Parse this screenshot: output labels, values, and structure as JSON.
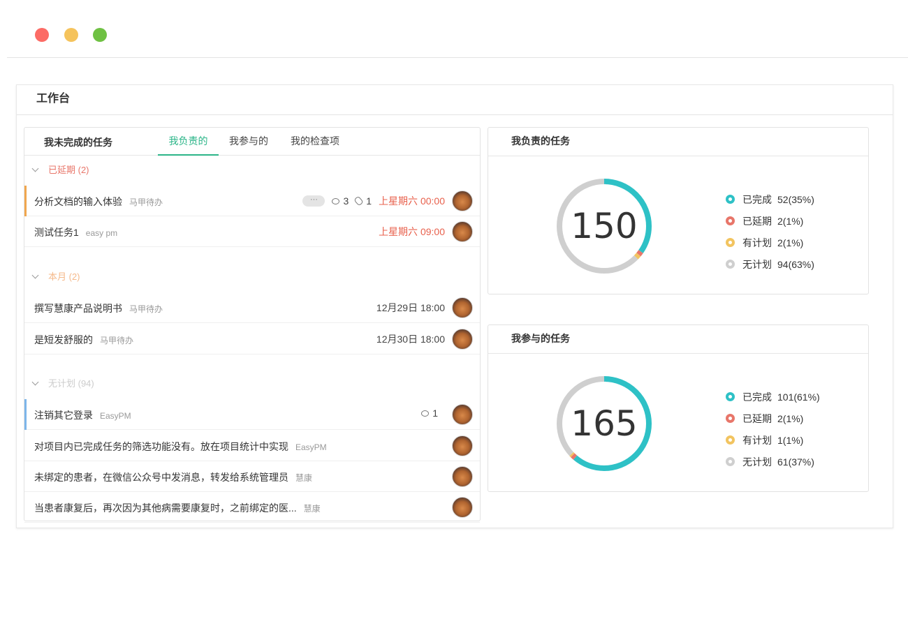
{
  "window": {
    "controls": [
      "close",
      "minimize",
      "zoom"
    ]
  },
  "workbench": {
    "title": "工作台"
  },
  "tasks": {
    "panel_title": "我未完成的任务",
    "tabs": [
      {
        "label": "我负责的",
        "active": true
      },
      {
        "label": "我参与的",
        "active": false
      },
      {
        "label": "我的检查项",
        "active": false
      }
    ],
    "groups": [
      {
        "label": "已延期 (2)",
        "color": "#e8766a",
        "rows": [
          {
            "title": "分析文档的输入体验",
            "project": "马甲待办",
            "accent": "#f0a64e",
            "more": "···",
            "comments": "3",
            "attachments": "1",
            "due": "上星期六 00:00",
            "late": true
          },
          {
            "title": "测试任务1",
            "project": "easy pm",
            "accent": "",
            "due": "上星期六 09:00",
            "late": true
          }
        ]
      },
      {
        "label": "本月 (2)",
        "color": "#f5b98a",
        "rows": [
          {
            "title": "撰写慧康产品说明书",
            "project": "马甲待办",
            "accent": "",
            "due": "12月29日 18:00",
            "late": false
          },
          {
            "title": "是短发舒服的",
            "project": "马甲待办",
            "accent": "",
            "due": "12月30日 18:00",
            "late": false
          }
        ]
      },
      {
        "label": "无计划 (94)",
        "color": "#cccccc",
        "rows": [
          {
            "title": "注销其它登录",
            "project": "EasyPM",
            "accent": "#7db6ea",
            "comments": "1",
            "due": "",
            "late": false
          },
          {
            "title": "对项目内已完成任务的筛选功能没有。放在项目统计中实现",
            "project": "EasyPM",
            "accent": "",
            "due": "",
            "late": false
          },
          {
            "title": "未绑定的患者，在微信公众号中发消息，转发给系统管理员",
            "project": "慧康",
            "accent": "",
            "due": "",
            "late": false
          },
          {
            "title": "当患者康复后，再次因为其他病需要康复时，之前绑定的医...",
            "project": "慧康",
            "accent": "",
            "due": "",
            "late": false
          }
        ]
      }
    ]
  },
  "stats": [
    {
      "title": "我负责的任务",
      "total": "150",
      "segments": [
        {
          "label": "已完成",
          "value": "52(35%)",
          "count": 52,
          "color": "#2ec1c6"
        },
        {
          "label": "已延期",
          "value": "2(1%)",
          "count": 2,
          "color": "#e8766a"
        },
        {
          "label": "有计划",
          "value": "2(1%)",
          "count": 2,
          "color": "#f2c460"
        },
        {
          "label": "无计划",
          "value": "94(63%)",
          "count": 94,
          "color": "#cfcfcf"
        }
      ]
    },
    {
      "title": "我参与的任务",
      "total": "165",
      "segments": [
        {
          "label": "已完成",
          "value": "101(61%)",
          "count": 101,
          "color": "#2ec1c6"
        },
        {
          "label": "已延期",
          "value": "2(1%)",
          "count": 2,
          "color": "#e8766a"
        },
        {
          "label": "有计划",
          "value": "1(1%)",
          "count": 1,
          "color": "#f2c460"
        },
        {
          "label": "无计划",
          "value": "61(37%)",
          "count": 61,
          "color": "#cfcfcf"
        }
      ]
    }
  ]
}
